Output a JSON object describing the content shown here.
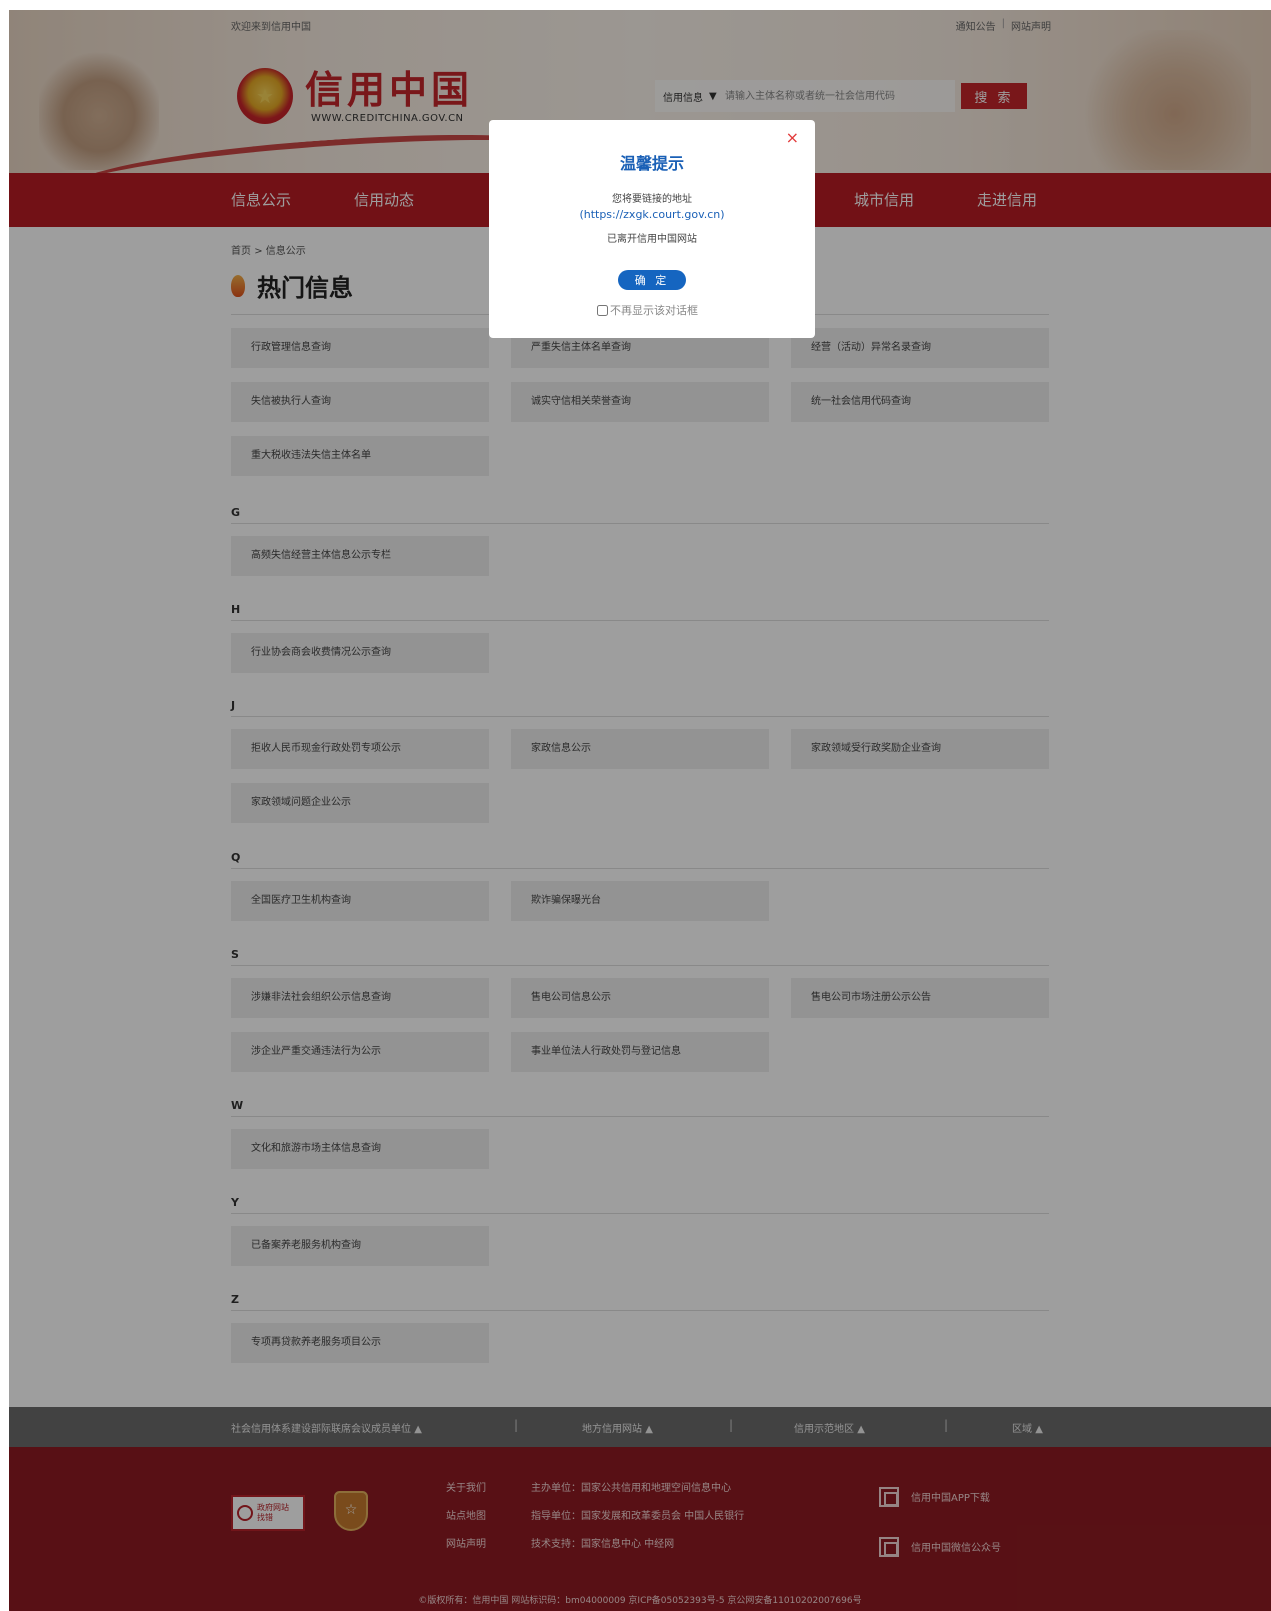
{
  "topbar": {
    "welcome": "欢迎来到信用中国",
    "links": [
      "通知公告",
      "网站声明"
    ],
    "separator": "|"
  },
  "logo": {
    "name": "信用中国",
    "url_text": "WWW.CREDITCHINA.GOV.CN"
  },
  "search": {
    "category": "信用信息",
    "placeholder": "请输入主体名称或者统一社会信用代码",
    "button": "搜 索"
  },
  "nav": {
    "items": [
      "信息公示",
      "信用动态",
      "城市信用",
      "走进信用"
    ]
  },
  "breadcrumb": {
    "home": "首页",
    "separator": ">",
    "current": "信息公示"
  },
  "title": "热门信息",
  "sections": {
    "hot": [
      "行政管理信息查询",
      "严重失信主体名单查询",
      "经营（活动）异常名录查询",
      "失信被执行人查询",
      "诚实守信相关荣誉查询",
      "统一社会信用代码查询",
      "重大税收违法失信主体名单"
    ],
    "G": [
      "高频失信经营主体信息公示专栏"
    ],
    "H": [
      "行业协会商会收费情况公示查询"
    ],
    "J": [
      "拒收人民币现金行政处罚专项公示",
      "家政信息公示",
      "家政领域受行政奖励企业查询",
      "家政领域问题企业公示"
    ],
    "Q": [
      "全国医疗卫生机构查询",
      "欺诈骗保曝光台"
    ],
    "S": [
      "涉嫌非法社会组织公示信息查询",
      "售电公司信息公示",
      "售电公司市场注册公示公告",
      "涉企业严重交通违法行为公示",
      "事业单位法人行政处罚与登记信息"
    ],
    "W": [
      "文化和旅游市场主体信息查询"
    ],
    "Y": [
      "已备案养老服务机构查询"
    ],
    "Z": [
      "专项再贷款养老服务项目公示"
    ]
  },
  "letters": [
    "G",
    "H",
    "J",
    "Q",
    "S",
    "W",
    "Y",
    "Z"
  ],
  "footer_bar": {
    "items": [
      "社会信用体系建设部际联席会议成员单位",
      "地方信用网站",
      "信用示范地区",
      "区域"
    ],
    "arrow": "▲",
    "sep": "|"
  },
  "footer": {
    "gov_badge": [
      "政府网站",
      "找错"
    ],
    "links": [
      "关于我们",
      "站点地图",
      "网站声明"
    ],
    "info": [
      "主办单位：国家公共信用和地理空间信息中心",
      "指导单位：国家发展和改革委员会 中国人民银行",
      "技术支持：国家信息中心 中经网"
    ],
    "qr": [
      "信用中国APP下载",
      "信用中国微信公众号"
    ],
    "copyright": "©版权所有：信用中国   网站标识码：bm04000009   京ICP备05052393号-5   京公网安备11010202007696号"
  },
  "modal": {
    "title": "温馨提示",
    "line1": "您将要链接的地址",
    "url": "(https://zxgk.court.gov.cn)",
    "line3": "已离开信用中国网站",
    "ok": "确 定",
    "checkbox_label": "不再显示该对话框",
    "close": "×"
  },
  "colors": {
    "brand_red": "#b81c24",
    "modal_blue": "#1565c0",
    "footer_red": "#8e1b22"
  }
}
